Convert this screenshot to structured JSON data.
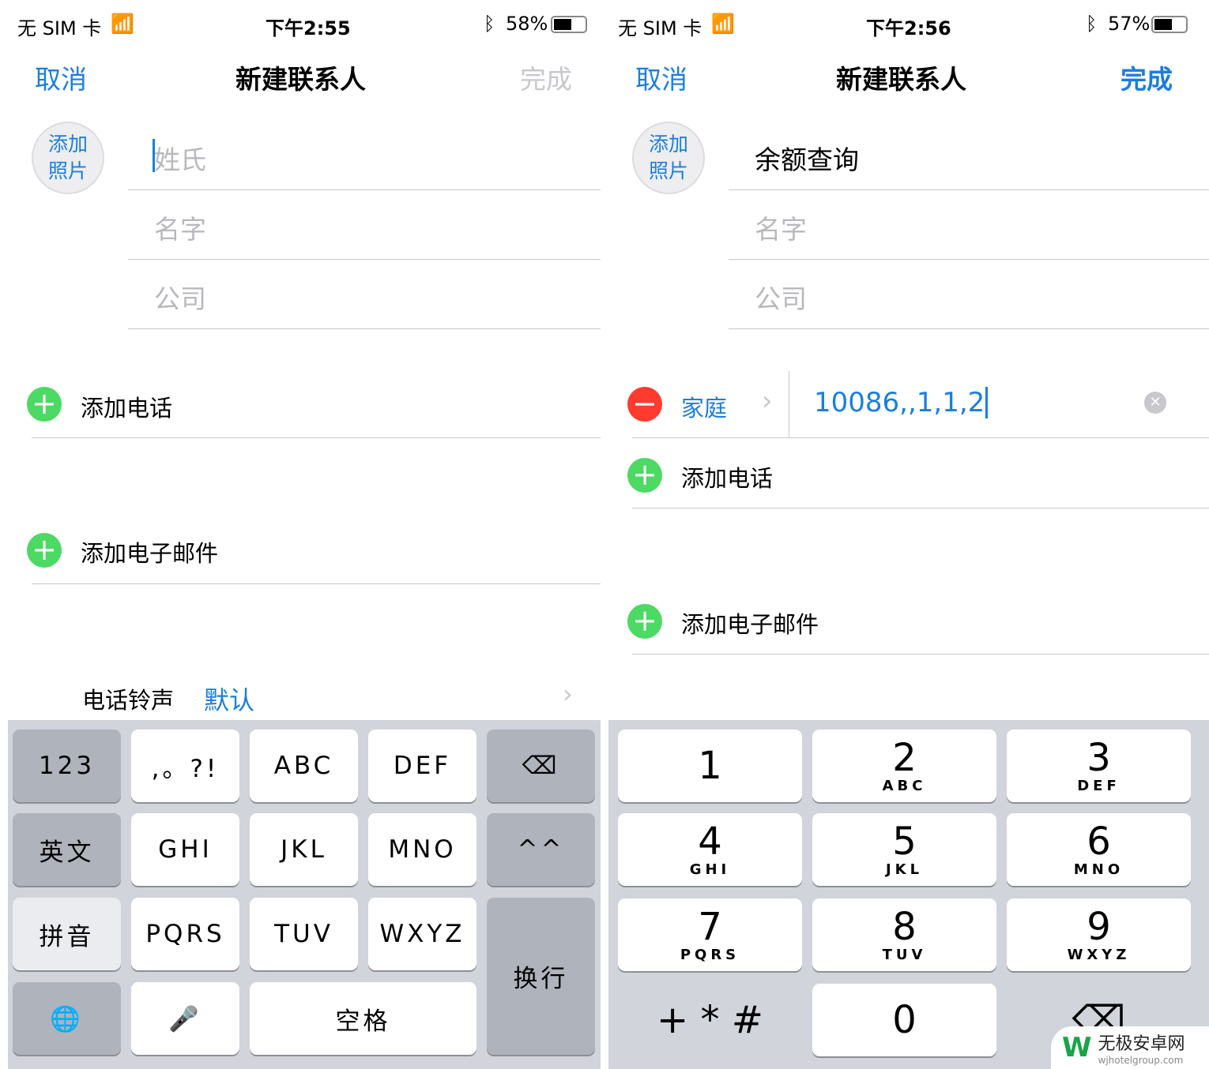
{
  "left": {
    "status": {
      "carrier": "无 SIM 卡",
      "time": "下午2:55",
      "battery": "58%",
      "battery_level": 0.58
    },
    "nav": {
      "cancel": "取消",
      "title": "新建联系人",
      "done": "完成"
    },
    "photo": {
      "line1": "添加",
      "line2": "照片"
    },
    "fields": {
      "last": "姓氏",
      "first": "名字",
      "company": "公司"
    },
    "add_phone": "添加电话",
    "add_email": "添加电子邮件",
    "ringtone": {
      "label": "电话铃声",
      "value": "默认"
    },
    "keyboard": [
      [
        {
          "t": "123",
          "s": "dark"
        },
        {
          "t": ",。?!"
        },
        {
          "t": "ABC"
        },
        {
          "t": "DEF"
        },
        {
          "t": "⌫",
          "s": "dark",
          "n": "delete"
        }
      ],
      [
        {
          "t": "英文",
          "s": "dark"
        },
        {
          "t": "GHI"
        },
        {
          "t": "JKL"
        },
        {
          "t": "MNO"
        },
        {
          "t": "^^",
          "s": "dark"
        }
      ],
      [
        {
          "t": "拼音",
          "s": "light"
        },
        {
          "t": "PQRS"
        },
        {
          "t": "TUV"
        },
        {
          "t": "WXYZ"
        },
        {
          "t": "换行",
          "s": "dark",
          "n": "return"
        }
      ],
      [
        {
          "t": "🌐",
          "s": "dark",
          "n": "globe"
        },
        {
          "t": "🎤",
          "n": "microphone"
        },
        {
          "t": "空格",
          "n": "space"
        }
      ]
    ]
  },
  "right": {
    "status": {
      "carrier": "无 SIM 卡",
      "time": "下午2:56",
      "battery": "57%",
      "battery_level": 0.57
    },
    "nav": {
      "cancel": "取消",
      "title": "新建联系人",
      "done": "完成"
    },
    "photo": {
      "line1": "添加",
      "line2": "照片"
    },
    "fields": {
      "last": "余额查询",
      "first": "名字",
      "company": "公司"
    },
    "phone": {
      "label": "家庭",
      "value": "10086,,1,1,2"
    },
    "add_phone": "添加电话",
    "add_email": "添加电子邮件",
    "keypad": [
      [
        {
          "n": "1",
          "l": ""
        },
        {
          "n": "2",
          "l": "ABC"
        },
        {
          "n": "3",
          "l": "DEF"
        }
      ],
      [
        {
          "n": "4",
          "l": "GHI"
        },
        {
          "n": "5",
          "l": "JKL"
        },
        {
          "n": "6",
          "l": "MNO"
        }
      ],
      [
        {
          "n": "7",
          "l": "PQRS"
        },
        {
          "n": "8",
          "l": "TUV"
        },
        {
          "n": "9",
          "l": "WXYZ"
        }
      ],
      [
        {
          "n": "+ * #",
          "l": "",
          "plain": true
        },
        {
          "n": "0",
          "l": ""
        },
        {
          "n": "⌫",
          "l": "",
          "plain": true
        }
      ]
    ]
  },
  "watermark": {
    "name": "无极安卓网",
    "url": "wjhotelgroup.com"
  },
  "colors": {
    "accent": "#1a7ee0",
    "add": "#4cd964",
    "remove": "#ff3b30",
    "keyboard_bg": "#d1d4da"
  }
}
